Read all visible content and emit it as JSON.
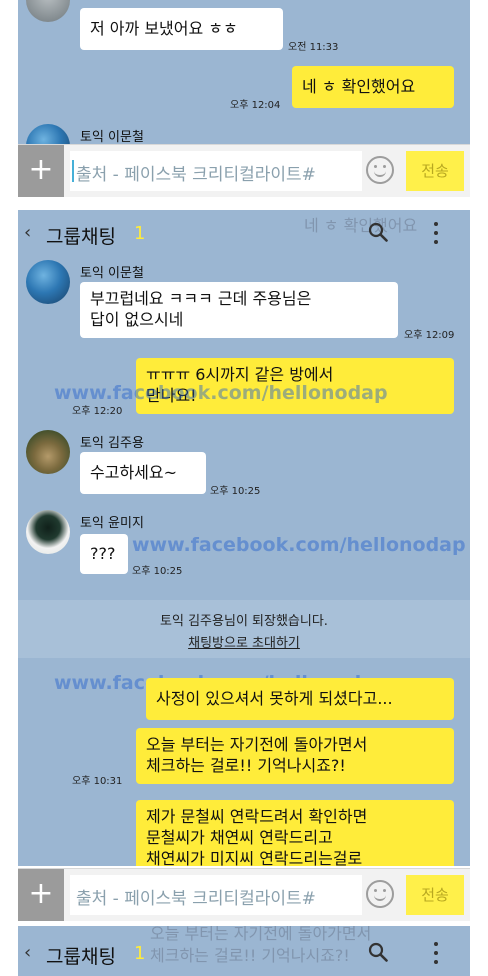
{
  "top_chat": {
    "partial_name": "토익 이문철",
    "messages": [
      {
        "text": "저 아까 보냈어요 ㅎㅎ",
        "time": "오전 11:33"
      },
      {
        "text": "네 ㅎ 확인했어요",
        "time": "오후 12:04"
      }
    ],
    "next_sender": "토익 이문철"
  },
  "input": {
    "plus_label": "+",
    "text": "출처 - 페이스북 크리티컬라이트#",
    "send_label": "전송"
  },
  "header": {
    "back_label": "‹",
    "title": "그룹채팅",
    "count": "1"
  },
  "chat": {
    "ghost_text": "네 ㅎ 확인했어요",
    "msg1": {
      "sender": "토익 이문철",
      "line1": "부끄럽네요 ㅋㅋㅋ 근데 주용님은",
      "line2": "답이 없으시네",
      "time": "오후 12:09"
    },
    "msg2": {
      "line1": "ㅠㅠㅠ 6시까지 같은 방에서",
      "line2": "만나요!",
      "time": "오후 12:20"
    },
    "msg3": {
      "sender": "토익 김주용",
      "text": "수고하세요~",
      "time": "오후 10:25"
    },
    "msg4": {
      "sender": "토익 윤미지",
      "text": "???",
      "time": "오후 10:25"
    },
    "system": {
      "line1": "토익 김주용님이 퇴장했습니다.",
      "line2": "채팅방으로 초대하기"
    },
    "msg5": {
      "text": "사정이 있으셔서 못하게 되셨다고..."
    },
    "msg6": {
      "line1": "오늘 부터는 자기전에 돌아가면서",
      "line2": "체크하는 걸로!! 기억나시죠?!",
      "time": "오후 10:31"
    },
    "msg7": {
      "line1": "제가 문철씨 연락드려서 확인하면",
      "line2": "문철씨가 채연씨 연락드리고",
      "line3": "채연씨가 미지씨 연락드리는걸로"
    }
  },
  "watermark": "www.facebook.com/hellonodap",
  "bottom_ghost": {
    "line1": "오늘 부터는 자기전에 돌아가면서",
    "line2": "체크하는 걸로!! 기억나시죠?!"
  },
  "colors": {
    "chat_bg": "#9bb6d2",
    "yellow_bubble": "#ffec3a",
    "white_bubble": "#ffffff",
    "send_button": "#fff04a"
  }
}
